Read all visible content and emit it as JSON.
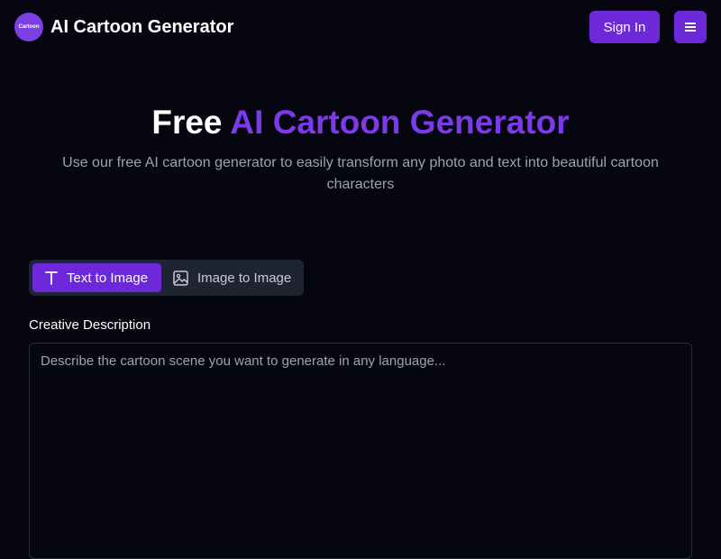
{
  "header": {
    "logo_text": "Cartoon",
    "title": "AI Cartoon Generator",
    "sign_in_label": "Sign In",
    "menu_icon": "hamburger-menu-icon"
  },
  "hero": {
    "title_plain": "Free",
    "title_accent": "AI Cartoon Generator",
    "subtitle": "Use our free AI cartoon generator to easily transform any photo and text into beautiful cartoon characters"
  },
  "tabs": [
    {
      "label": "Text to Image",
      "icon": "text-t-icon",
      "active": true
    },
    {
      "label": "Image to Image",
      "icon": "image-icon",
      "active": false
    }
  ],
  "form": {
    "description_label": "Creative Description",
    "description_value": "",
    "description_placeholder": "Describe the cartoon scene you want to generate in any language..."
  },
  "colors": {
    "background": "#05060f",
    "accent": "#7c3aed",
    "button": "#6d28d9",
    "muted_text": "#9ca3af",
    "tab_bar": "#1f2433"
  }
}
